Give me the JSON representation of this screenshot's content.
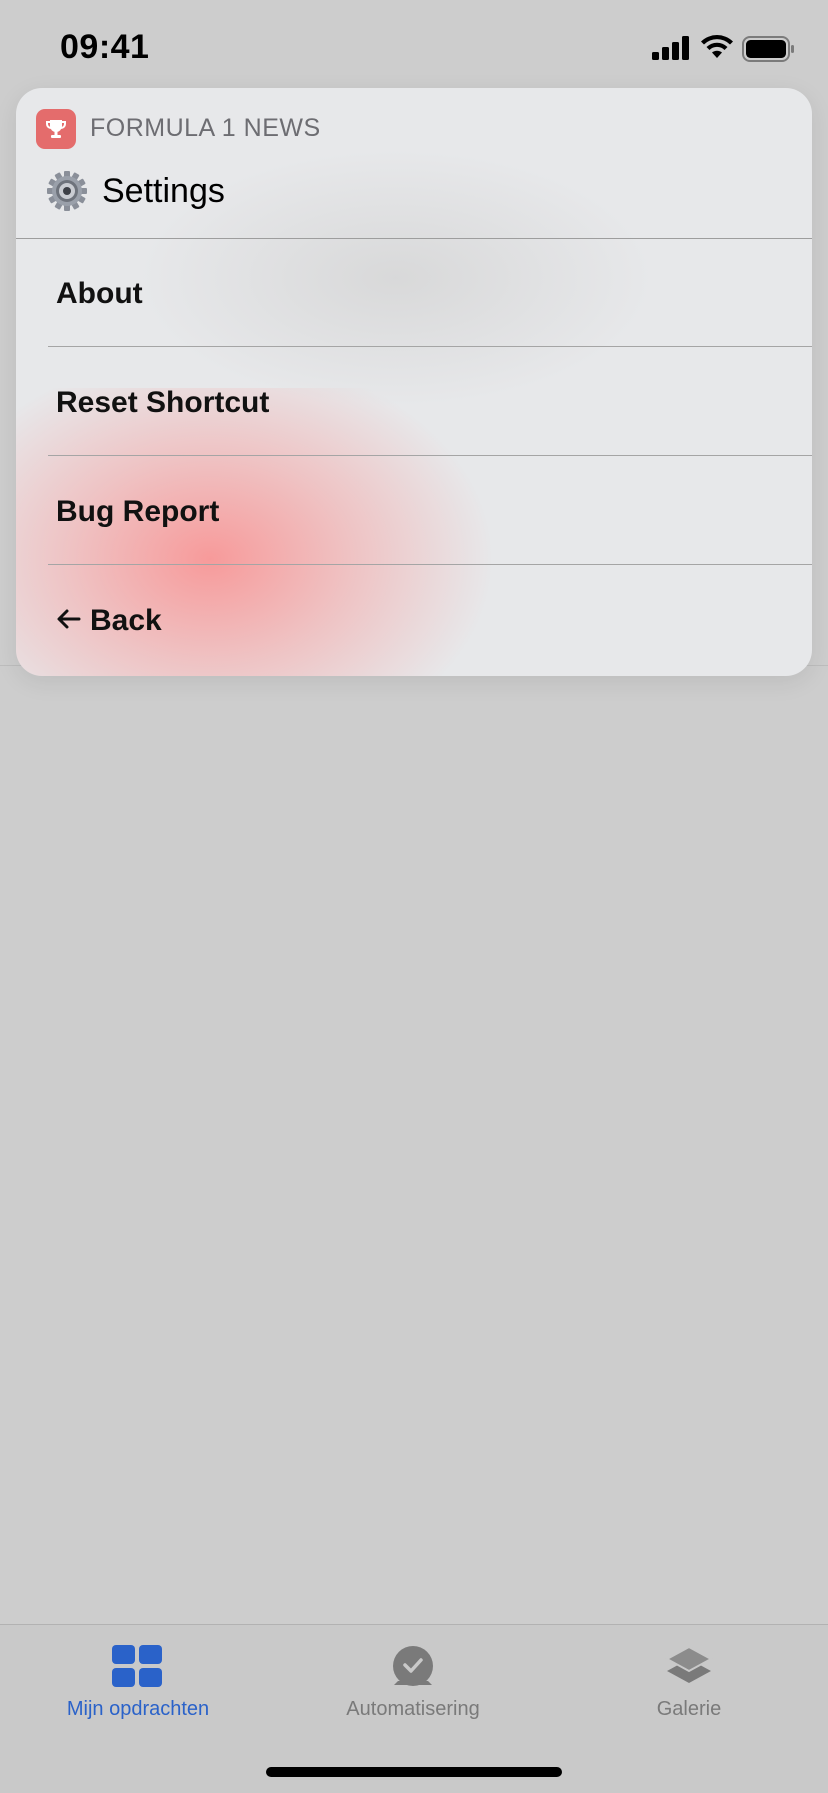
{
  "status_bar": {
    "time": "09:41"
  },
  "card": {
    "app_name": "FORMULA 1 NEWS",
    "title": "Settings",
    "items": [
      {
        "label": "About"
      },
      {
        "label": "Reset Shortcut"
      },
      {
        "label": "Bug Report"
      },
      {
        "label": "Back"
      }
    ]
  },
  "tab_bar": {
    "tabs": [
      {
        "label": "Mijn opdrachten",
        "icon": "grid-icon",
        "active": true
      },
      {
        "label": "Automatisering",
        "icon": "clock-check-icon",
        "active": false
      },
      {
        "label": "Galerie",
        "icon": "layers-icon",
        "active": false
      }
    ]
  },
  "colors": {
    "accent": "#2a62c9",
    "app_icon": "#e46c6c",
    "glow": "#f89696"
  }
}
